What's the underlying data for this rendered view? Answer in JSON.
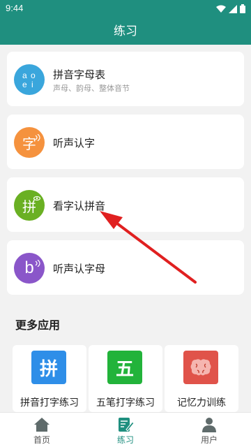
{
  "status_bar": {
    "time": "9:44"
  },
  "app_bar": {
    "title": "练习"
  },
  "cards": [
    {
      "title": "拼音字母表",
      "subtitle": "声母、韵母、整体音节",
      "icon": "pinyin-alphabet-icon",
      "color": "#3aa6dc"
    },
    {
      "title": "听声认字",
      "icon": "zi-character-icon",
      "glyph": "字",
      "color": "#f5923e"
    },
    {
      "title": "看字认拼音",
      "icon": "pin-character-icon",
      "glyph": "拼",
      "color": "#6ab023"
    },
    {
      "title": "听声认字母",
      "icon": "letter-b-icon",
      "glyph": "b",
      "color": "#8a56c9"
    }
  ],
  "more_apps": {
    "title": "更多应用",
    "items": [
      {
        "label": "拼音打字练习",
        "glyph": "拼",
        "icon": "pinyin-typing-icon",
        "color": "#2e8ee8"
      },
      {
        "label": "五笔打字练习",
        "glyph": "五",
        "icon": "wubi-typing-icon",
        "color": "#22b33a"
      },
      {
        "label": "记忆力训练",
        "icon": "brain-icon",
        "color": "#e0534a"
      }
    ]
  },
  "bottom_nav": {
    "items": [
      {
        "label": "首页",
        "icon": "home-icon"
      },
      {
        "label": "练习",
        "icon": "practice-icon",
        "active": true
      },
      {
        "label": "用户",
        "icon": "user-icon"
      }
    ]
  },
  "colors": {
    "primary": "#1f8f7f",
    "arrow": "#e02020"
  }
}
